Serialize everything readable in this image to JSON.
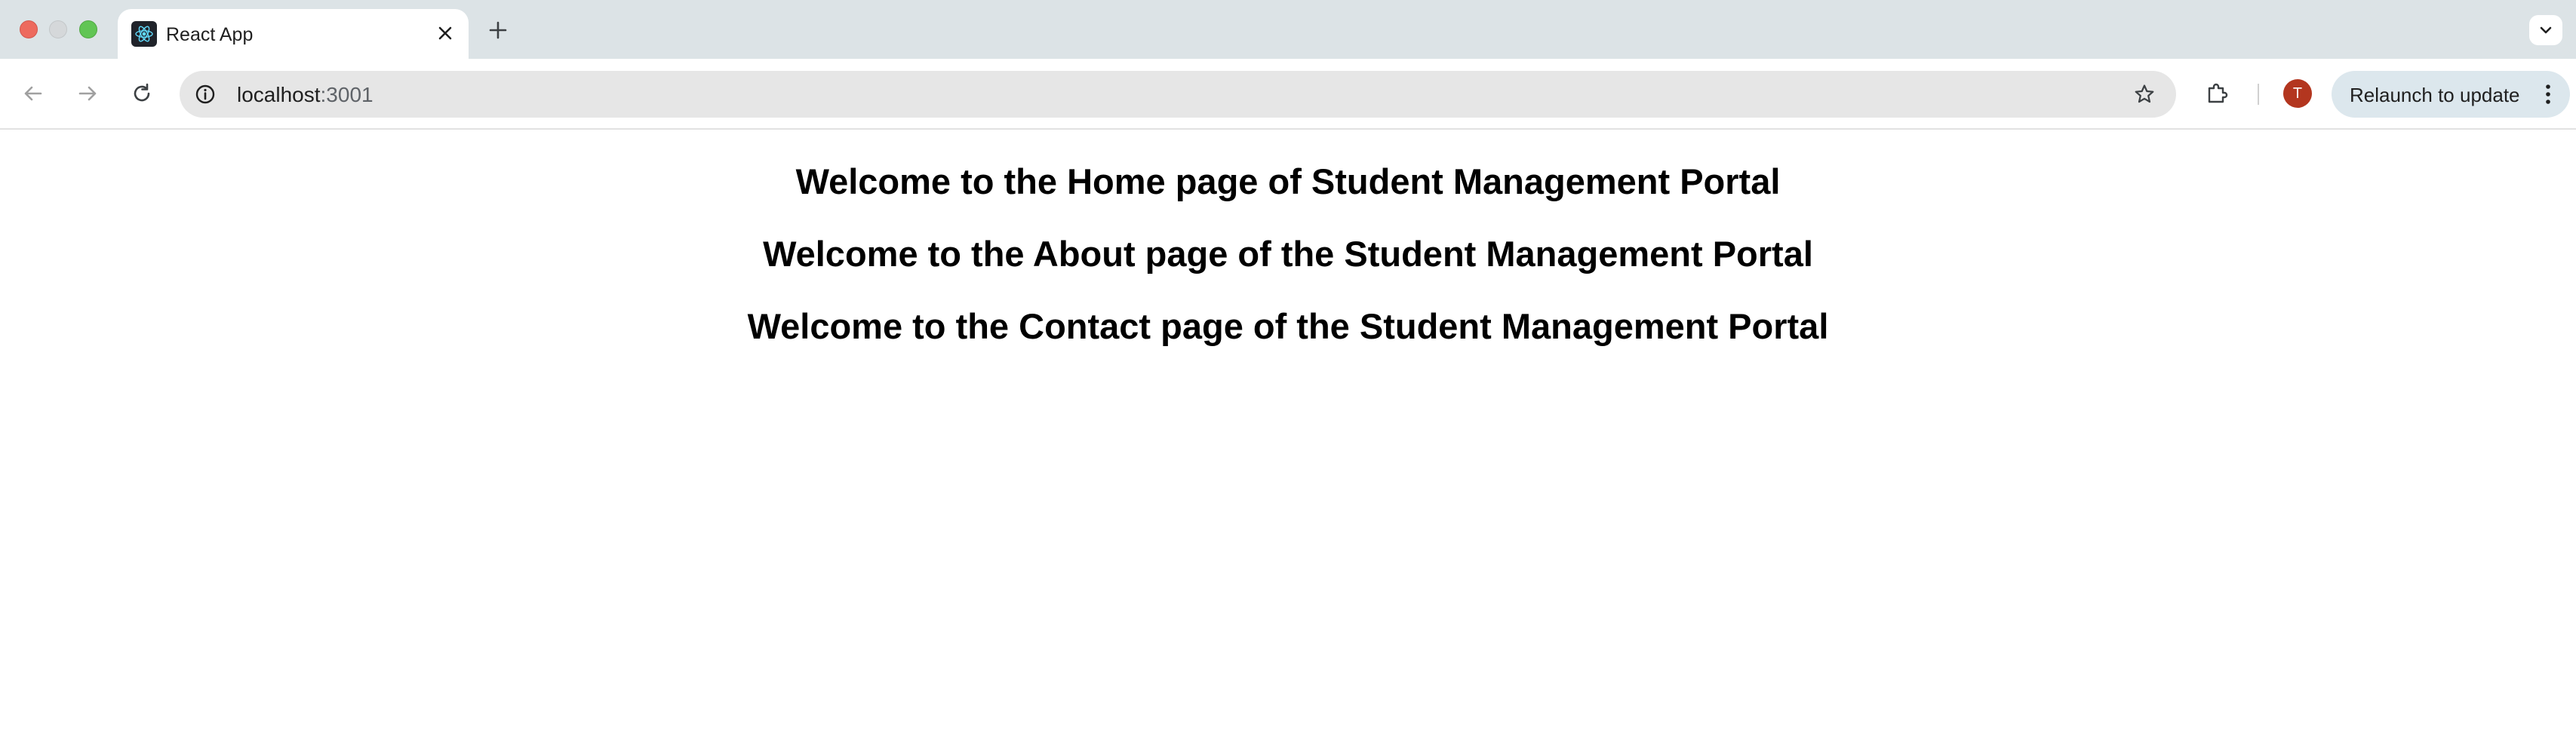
{
  "browser": {
    "tab": {
      "title": "React App",
      "favicon": "react-logo-icon"
    },
    "new_tab_icon": "plus-icon",
    "tab_search_icon": "chevron-down-icon",
    "toolbar": {
      "back_icon": "arrow-left-icon",
      "forward_icon": "arrow-right-icon",
      "reload_icon": "reload-icon",
      "address": {
        "host": "localhost",
        "port": ":3001",
        "info_icon": "info-icon",
        "bookmark_icon": "star-icon"
      },
      "extensions_icon": "puzzle-icon",
      "profile_initial": "T",
      "relaunch_label": "Relaunch to update",
      "menu_icon": "kebab-menu-icon"
    },
    "colors": {
      "tabstrip_bg": "#dce3e6",
      "close": "#ed6a5e",
      "minimize": "#d5d8da",
      "maximize": "#61c554",
      "avatar": "#b3361f",
      "relaunch_bg": "#dce7ed"
    }
  },
  "page": {
    "headings": [
      "Welcome to the Home page of Student Management Portal",
      "Welcome to the About page of the Student Management Portal",
      "Welcome to the Contact page of the Student Management Portal"
    ]
  }
}
